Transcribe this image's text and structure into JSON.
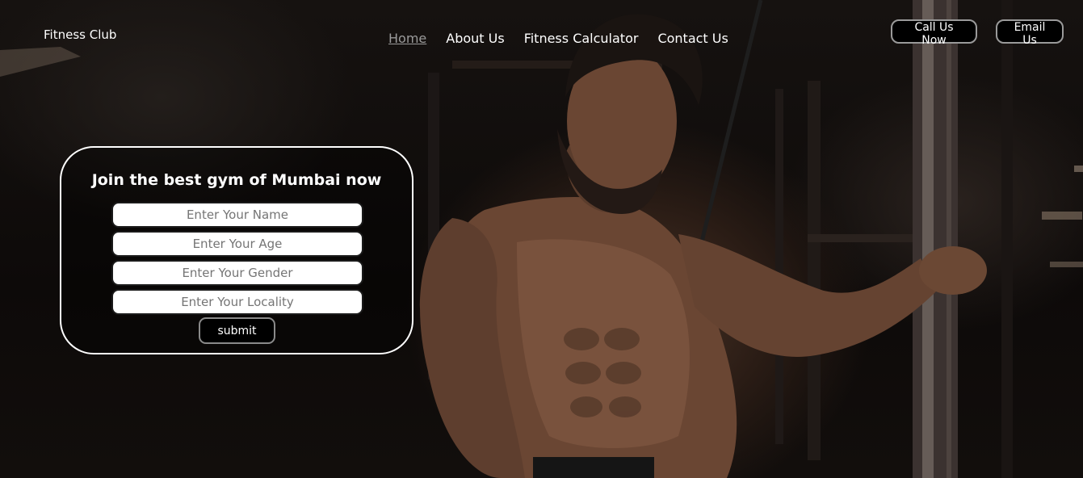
{
  "header": {
    "brand": "Fitness Club",
    "nav": [
      {
        "label": "Home",
        "active": true
      },
      {
        "label": "About Us",
        "active": false
      },
      {
        "label": "Fitness Calculator",
        "active": false
      },
      {
        "label": "Contact Us",
        "active": false
      }
    ],
    "call_button": "Call Us Now",
    "email_button": "Email Us"
  },
  "form": {
    "title": "Join the best gym of Mumbai now",
    "fields": [
      {
        "placeholder": "Enter Your Name",
        "value": ""
      },
      {
        "placeholder": "Enter Your Age",
        "value": ""
      },
      {
        "placeholder": "Enter Your Gender",
        "value": ""
      },
      {
        "placeholder": "Enter Your Locality",
        "value": ""
      }
    ],
    "submit_label": "submit"
  },
  "hero": {
    "image": "bodybuilder-cable-gym-photo"
  },
  "colors": {
    "background": "#0b0908",
    "text": "#ffffff",
    "active_nav": "#9a9a9a",
    "button_bg": "#000000",
    "button_border": "#9a9a9a"
  }
}
